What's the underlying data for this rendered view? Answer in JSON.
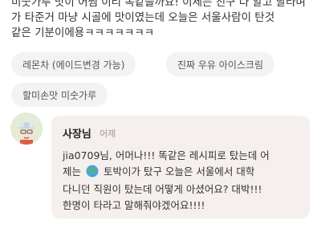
{
  "review": {
    "lines": [
      "미숫가루 맛이 어쩜 이리 똑같을까요! 이제는 친구 다 알고 달라며",
      "가 타준거 마냥 시골에 맛이였는데 오늘은 서울사람이 탄것",
      "같은 기분이에용ㅋㅋㅋㅋㅋㅋㅋ"
    ]
  },
  "menu_tags": [
    "레몬차 (에이드변경 가능)",
    "진짜 우유 아이스크림",
    "할미손맛 미숫가루"
  ],
  "owner_reply": {
    "name": "사장님",
    "date": "어제",
    "line1": "jia0709님, 어머나!!! 똑같은 레시피로 탔는데 어",
    "line2_before": "제는",
    "line2_after": "토박이가 탔구 오늘은 서울에서 대학",
    "line3": "다니던 직원이 탔는데 어떻게 아셨어요? 대박!!!",
    "line4": "한명이 타라고 말해줘야겠어요!!!!",
    "inline_icon": "globe-icon"
  },
  "colors": {
    "chip_bg": "#f3f3f3",
    "reply_bg": "#f5f0ee",
    "muted_text": "#999999"
  }
}
